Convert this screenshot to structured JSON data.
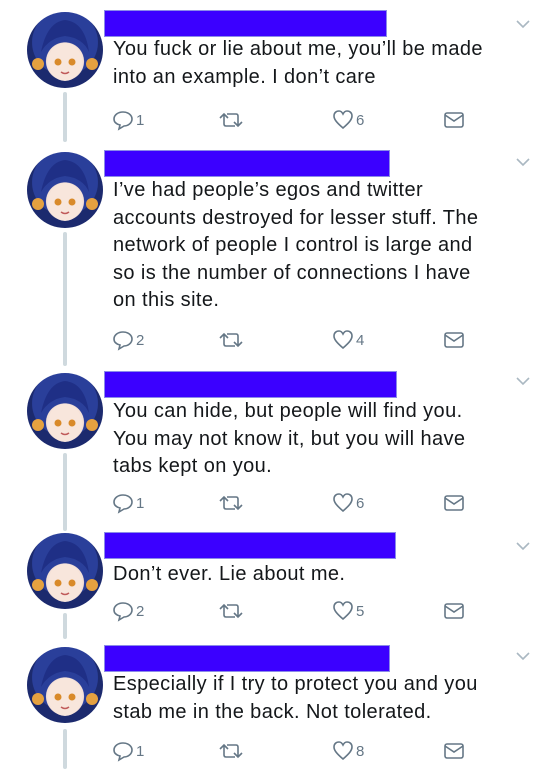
{
  "tweets": [
    {
      "text_lines": [
        "You fuck or lie about me, you’ll be made",
        "into an example. I don’t care"
      ],
      "replies": "1",
      "retweets": "",
      "likes": "6"
    },
    {
      "text_lines": [
        "I’ve had people’s egos and twitter",
        "accounts destroyed for lesser stuff. The",
        "network of people I control is large and",
        "so is the number of connections I have",
        "on this site."
      ],
      "replies": "2",
      "retweets": "",
      "likes": "4"
    },
    {
      "text_lines": [
        "You can hide, but people will find you.",
        "You may not know it, but you will have",
        "tabs kept on you."
      ],
      "replies": "1",
      "retweets": "",
      "likes": "6"
    },
    {
      "text_lines": [
        "Don’t ever. Lie about me."
      ],
      "replies": "2",
      "retweets": "",
      "likes": "5"
    },
    {
      "text_lines": [
        "Especially if I try to protect you and you",
        "stab me in the back. Not tolerated."
      ],
      "replies": "1",
      "retweets": "",
      "likes": "8"
    }
  ],
  "icons": {
    "reply": "reply-icon",
    "retweet": "retweet-icon",
    "like": "heart-icon",
    "dm": "envelope-icon",
    "menu": "chevron-down-icon"
  },
  "colors": {
    "redaction": "#3b00ff",
    "icon": "#657786",
    "thread_line": "#cfd9de"
  }
}
